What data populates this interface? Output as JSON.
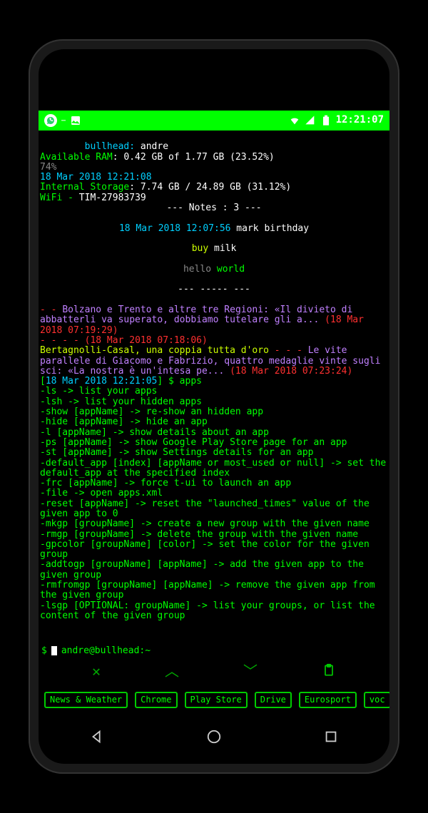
{
  "status": {
    "clock": "12:21:07"
  },
  "header": {
    "hostline_a": "bullhead:",
    "hostline_b": " andre",
    "ram_a": "Available RAM",
    "ram_b": ": 0.42 GB of 1.77 GB (23.52%)",
    "pct": "74%",
    "time1": "18 Mar 2018 12:21:08",
    "storage_a": "Internal Storage",
    "storage_b": ": 7.74 GB / 24.89 GB (31.12%)",
    "wifi_a": "WiFi - ",
    "wifi_b": "TIM-27983739"
  },
  "notes": {
    "title": "--- Notes : 3 ---",
    "n1_time": "18 Mar 2018 12:07:56",
    "n1_text": " mark birthday",
    "n2_a": "buy ",
    "n2_b": "milk",
    "n3_a": "hello ",
    "n3_b": "world",
    "sep": "--- ----- ---"
  },
  "feed": {
    "a1": "- - ",
    "a2": "Bolzano e Trento e altre tre Regioni: «Il divieto di abbatterli va superato, dobbiamo tutelare gli a...",
    "a3": " (18 Mar 2018 07:19:29)",
    "b1": "- - - - ",
    "b2": "(18 Mar 2018 07:18:06)",
    "c1": "Bertagnolli-Casal, una coppia tutta d'oro",
    "c2": " - - - ",
    "c3": "Le vite parallele di Giacomo e Fabrizio, quattro medaglie vinte sugli sci: «La nostra è un'intesa pe...",
    "c4": " (18 Mar 2018 07:23:24)"
  },
  "cmd": {
    "br": "[",
    "time": "18 Mar 2018 12:21:05",
    "rest": "] $ apps"
  },
  "help": [
    "-ls -> list your apps",
    "-lsh -> list your hidden apps",
    "-show [appName] -> re-show an hidden app",
    "-hide [appName] -> hide an app",
    "-l [appName] -> show details about an app",
    "-ps [appName] -> show Google Play Store page for an app",
    "-st [appName] -> show Settings details for an app",
    "-default_app [index] [appName or most_used or null] -> set the default_app at the specified index",
    "-frc [appName] -> force t-ui to launch an app",
    "-file -> open apps.xml",
    "-reset [appName] -> reset the \"launched_times\" value of the given app to 0",
    "-mkgp [groupName] -> create a new group with the given name",
    "-rmgp [groupName] -> delete the group with the given name",
    "-gpcolor [groupName] [color] -> set the color for the given group",
    "-addtogp [groupName] [appName] -> add the given app to the given group",
    "-rmfromgp [groupName] [appName] -> remove the given app from the given group",
    "-lsgp [OPTIONAL: groupName] -> list your groups, or list the content of the given group"
  ],
  "prompt": {
    "symbol": "$",
    "value": "andre@bullhead:~"
  },
  "apps": [
    "News & Weather",
    "Chrome",
    "Play Store",
    "Drive",
    "Eurosport",
    "voc"
  ]
}
